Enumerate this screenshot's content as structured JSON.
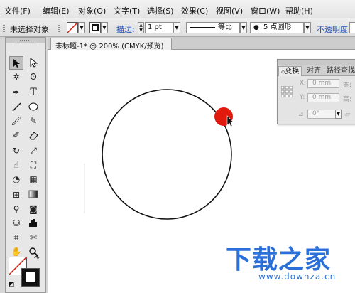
{
  "menu": {
    "items": [
      "文件(F)",
      "编辑(E)",
      "对象(O)",
      "文字(T)",
      "选择(S)",
      "效果(C)",
      "视图(V)",
      "窗口(W)",
      "帮助(H)"
    ]
  },
  "control_bar": {
    "selection_status": "未选择对象",
    "stroke_label": "描边:",
    "stroke_weight": "1 pt",
    "stroke_profile": "等比",
    "brush": "5 点圆形",
    "opacity_label": "不透明度"
  },
  "document": {
    "tab_title": "未标题-1* @ 200% (CMYK/预览)"
  },
  "transform_panel": {
    "tabs": [
      "变换",
      "对齐",
      "路径查找"
    ],
    "x_label": "X:",
    "y_label": "Y:",
    "w_label": "宽:",
    "h_label": "高:",
    "x_value": "0 mm",
    "y_value": "0 mm",
    "angle_value": "0°"
  },
  "watermark": {
    "title": "下载之家",
    "url": "www.downza.cn"
  },
  "colors": {
    "click_indicator": "#e21a0e",
    "watermark": "#2b6fd8",
    "link": "#1f4fb8"
  },
  "icons": {
    "selection_tool": "arrow-icon",
    "direct_selection_tool": "hollow-arrow-icon",
    "magic_wand_tool": "magic-wand-icon",
    "lasso_tool": "lasso-icon",
    "pen_tool": "pen-icon",
    "type_tool": "type-icon",
    "line_tool": "line-icon",
    "ellipse_tool": "ellipse-icon",
    "paintbrush_tool": "brush-icon",
    "pencil_tool": "pencil-icon",
    "blob_brush_tool": "blob-brush-icon",
    "eraser_tool": "eraser-icon",
    "rotate_tool": "rotate-icon",
    "scale_tool": "scale-icon",
    "warp_tool": "warp-icon",
    "free_transform_tool": "free-transform-icon",
    "shape_builder_tool": "shape-builder-icon",
    "perspective_grid_tool": "perspective-grid-icon",
    "mesh_tool": "mesh-icon",
    "gradient_tool": "gradient-icon",
    "eyedropper_tool": "eyedropper-icon",
    "blend_tool": "blend-icon",
    "symbol_sprayer_tool": "symbol-sprayer-icon",
    "graph_tool": "bar-graph-icon",
    "artboard_tool": "artboard-icon",
    "slice_tool": "slice-icon",
    "hand_tool": "hand-icon",
    "zoom_tool": "magnifier-icon"
  }
}
